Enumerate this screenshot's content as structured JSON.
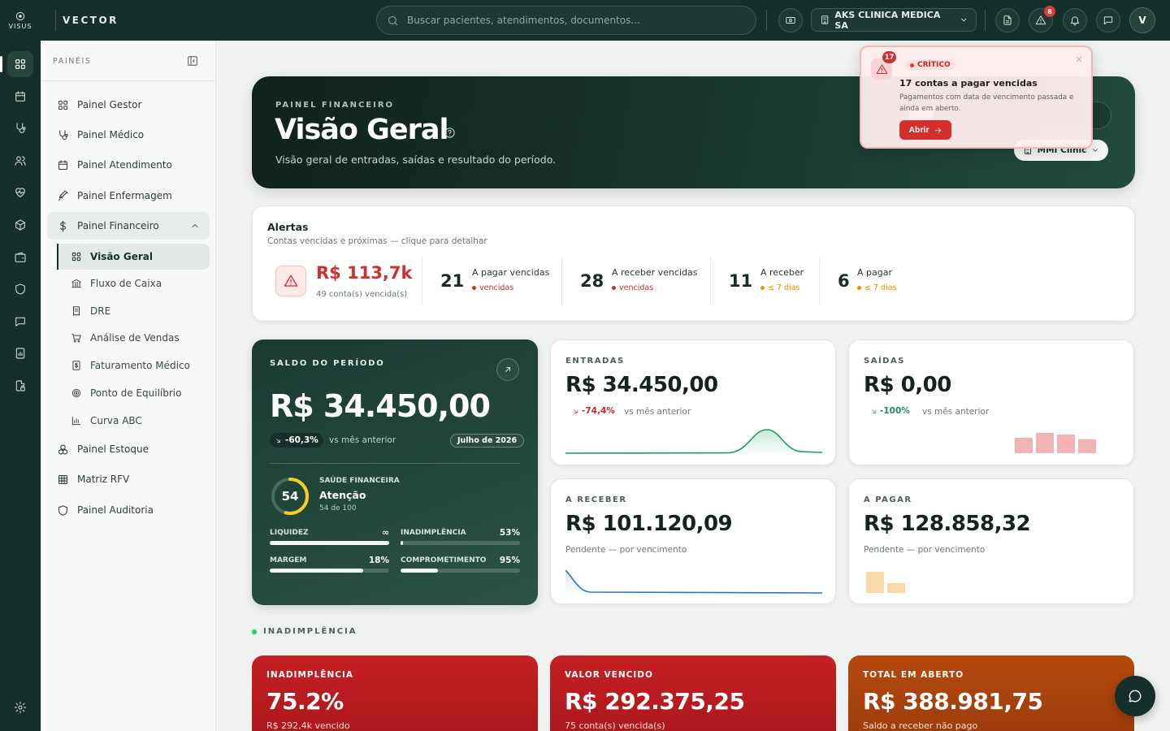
{
  "app": {
    "logo_text": "VISUS",
    "brand": "VECTOR"
  },
  "header": {
    "search_placeholder": "Buscar pacientes, atendimentos, documentos...",
    "company": "AKS CLINICA MEDICA SA",
    "alerts_badge": "8",
    "user_initial": "V"
  },
  "sidebar": {
    "title": "PAINÉIS",
    "items": [
      {
        "label": "Painel Gestor",
        "icon": "grid-icon"
      },
      {
        "label": "Painel Médico",
        "icon": "stethoscope-icon"
      },
      {
        "label": "Painel Atendimento",
        "icon": "calendar-icon"
      },
      {
        "label": "Painel Enfermagem",
        "icon": "syringe-icon"
      },
      {
        "label": "Painel Financeiro",
        "icon": "dollar-icon"
      },
      {
        "label": "Painel Estoque",
        "icon": "boxes-icon"
      },
      {
        "label": "Matriz RFV",
        "icon": "table-icon"
      },
      {
        "label": "Painel Auditoria",
        "icon": "shield-icon"
      }
    ],
    "sub_items": [
      {
        "label": "Visão Geral",
        "icon": "grid-icon"
      },
      {
        "label": "Fluxo de Caixa",
        "icon": "bank-icon"
      },
      {
        "label": "DRE",
        "icon": "receipt-icon"
      },
      {
        "label": "Análise de Vendas",
        "icon": "cart-icon"
      },
      {
        "label": "Faturamento Médico",
        "icon": "invoice-icon"
      },
      {
        "label": "Ponto de Equilíbrio",
        "icon": "target-icon"
      },
      {
        "label": "Curva ABC",
        "icon": "bar-chart-icon"
      }
    ]
  },
  "hero": {
    "kicker": "PAINEL FINANCEIRO",
    "title": "Visão Geral",
    "description": "Visão geral de entradas, saídas e resultado do período.",
    "clinic": "MMI Clinic"
  },
  "popup": {
    "count": "17",
    "level": "CRÍTICO",
    "title": "17 contas a pagar vencidas",
    "text": "Pagamentos com data de vencimento passada e ainda em aberto.",
    "button": "Abrir"
  },
  "alerts": {
    "title": "Alertas",
    "subtitle": "Contas vencidas e próximas — clique para detalhar",
    "main_value": "R$ 113,7k",
    "main_sub": "49 conta(s) vencida(s)",
    "items": [
      {
        "n": "21",
        "label": "A pagar vencidas",
        "sub": "vencidas",
        "color": "#d32f2f"
      },
      {
        "n": "28",
        "label": "A receber vencidas",
        "sub": "vencidas",
        "color": "#d32f2f"
      },
      {
        "n": "11",
        "label": "A receber",
        "sub": "≤ 7 dias",
        "color": "#e69500"
      },
      {
        "n": "6",
        "label": "A pagar",
        "sub": "≤ 7 dias",
        "color": "#e69500"
      }
    ]
  },
  "saldo": {
    "label": "SALDO DO PERÍODO",
    "value": "R$ 34.450,00",
    "change": "-60,3%",
    "vs": "vs mês anterior",
    "month": "Julho de 2026",
    "health_score": "54",
    "health_score_value": 54,
    "health_label": "SAÚDE FINANCEIRA",
    "health_status": "Atenção",
    "health_sub": "54 de 100",
    "metrics": [
      {
        "label": "LIQUIDEZ",
        "value": "∞",
        "fill": 1.0
      },
      {
        "label": "INADIMPLÊNCIA",
        "value": "53%",
        "fill": 0.02
      },
      {
        "label": "MARGEM",
        "value": "18%",
        "fill": 0.78
      },
      {
        "label": "COMPROMETIMENTO",
        "value": "95%",
        "fill": 0.31
      }
    ]
  },
  "kpis": {
    "entradas": {
      "label": "ENTRADAS",
      "value": "R$ 34.450,00",
      "change": "-74,4%",
      "vs": "vs mês anterior",
      "change_color": "#c62828"
    },
    "saidas": {
      "label": "SAÍDAS",
      "value": "R$ 0,00",
      "change": "-100%",
      "vs": "vs mês anterior",
      "change_color": "#1e8c5a"
    },
    "receber": {
      "label": "A RECEBER",
      "value": "R$ 101.120,09",
      "sub": "Pendente — por vencimento"
    },
    "pagar": {
      "label": "A PAGAR",
      "value": "R$ 128.858,32",
      "sub": "Pendente — por vencimento"
    }
  },
  "section": {
    "label": "INADIMPLÊNCIA"
  },
  "bottom_cards": [
    {
      "label": "INADIMPLÊNCIA",
      "value": "75.2%",
      "sub": "R$ 292,4k vencido"
    },
    {
      "label": "VALOR VENCIDO",
      "value": "R$ 292.375,25",
      "sub": "75 conta(s) vencida(s)"
    },
    {
      "label": "TOTAL EM ABERTO",
      "value": "R$ 388.981,75",
      "sub": "Saldo a receber não pago"
    }
  ],
  "colors": {
    "primary": "#15302a",
    "danger": "#d32f2f",
    "warning": "#e69500",
    "success": "#1e8c5a"
  }
}
